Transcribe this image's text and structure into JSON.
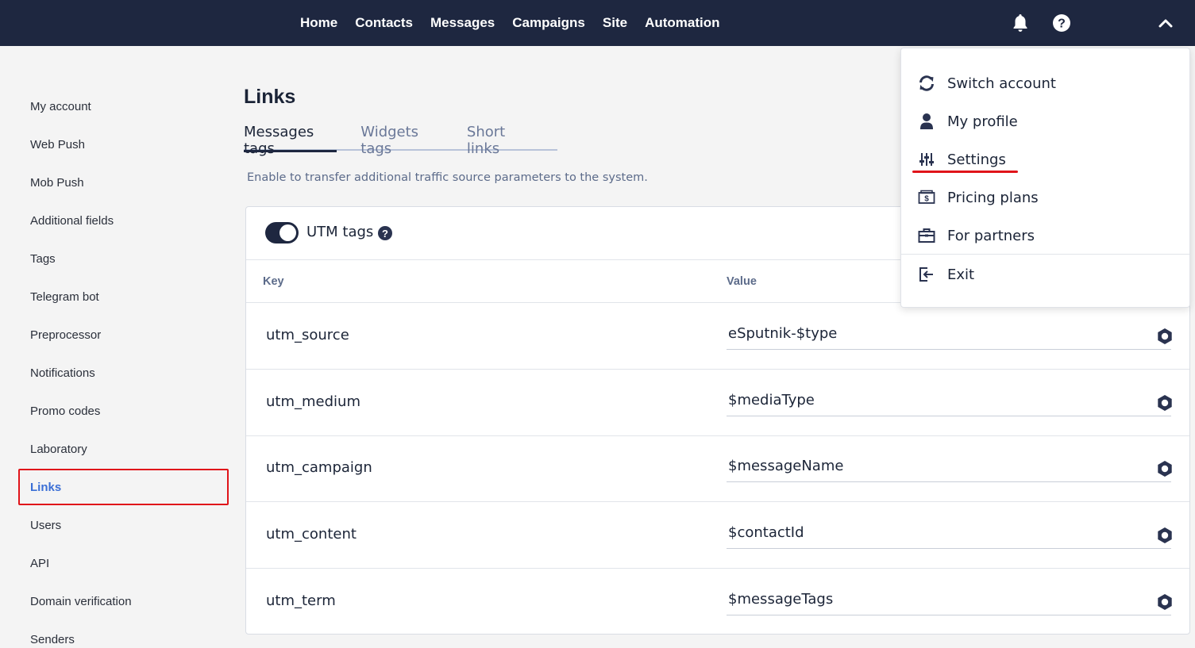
{
  "nav": {
    "items": [
      "Home",
      "Contacts",
      "Messages",
      "Campaigns",
      "Site",
      "Automation"
    ]
  },
  "topbar_icons": [
    "bell-icon",
    "help-icon",
    "chevron-up-icon"
  ],
  "sidebar": {
    "items": [
      {
        "label": "My account"
      },
      {
        "label": "Web Push"
      },
      {
        "label": "Mob Push"
      },
      {
        "label": "Additional fields"
      },
      {
        "label": "Tags"
      },
      {
        "label": "Telegram bot"
      },
      {
        "label": "Preprocessor"
      },
      {
        "label": "Notifications"
      },
      {
        "label": "Promo codes"
      },
      {
        "label": "Laboratory"
      },
      {
        "label": "Links"
      },
      {
        "label": "Users"
      },
      {
        "label": "API"
      },
      {
        "label": "Domain verification"
      },
      {
        "label": "Senders"
      }
    ],
    "active": "Links"
  },
  "main": {
    "title": "Links",
    "tabs": [
      {
        "label": "Messages tags"
      },
      {
        "label": "Widgets tags"
      },
      {
        "label": "Short links"
      }
    ],
    "active_tab": "Messages tags",
    "hint": "Enable to transfer additional traffic source parameters to the system.",
    "utm": {
      "toggle_label": "UTM tags",
      "enabled": true,
      "help_glyph": "?",
      "columns": {
        "key": "Key",
        "value": "Value"
      },
      "rows": [
        {
          "key": "utm_source",
          "value": "eSputnik-$type"
        },
        {
          "key": "utm_medium",
          "value": "$mediaType"
        },
        {
          "key": "utm_campaign",
          "value": "$messageName"
        },
        {
          "key": "utm_content",
          "value": "$contactId"
        },
        {
          "key": "utm_term",
          "value": "$messageTags"
        }
      ]
    }
  },
  "dropdown": {
    "items": [
      {
        "label": "Switch account",
        "icon": "switch-account-icon"
      },
      {
        "label": "My profile",
        "icon": "user-icon"
      },
      {
        "label": "Settings",
        "icon": "sliders-icon"
      },
      {
        "label": "Pricing plans",
        "icon": "pricing-icon"
      },
      {
        "label": "For partners",
        "icon": "briefcase-icon"
      },
      {
        "label": "Exit",
        "icon": "exit-icon"
      }
    ]
  },
  "colors": {
    "topbar": "#1e2740",
    "highlight": "#e0141a",
    "active_link": "#3b6fd6"
  }
}
